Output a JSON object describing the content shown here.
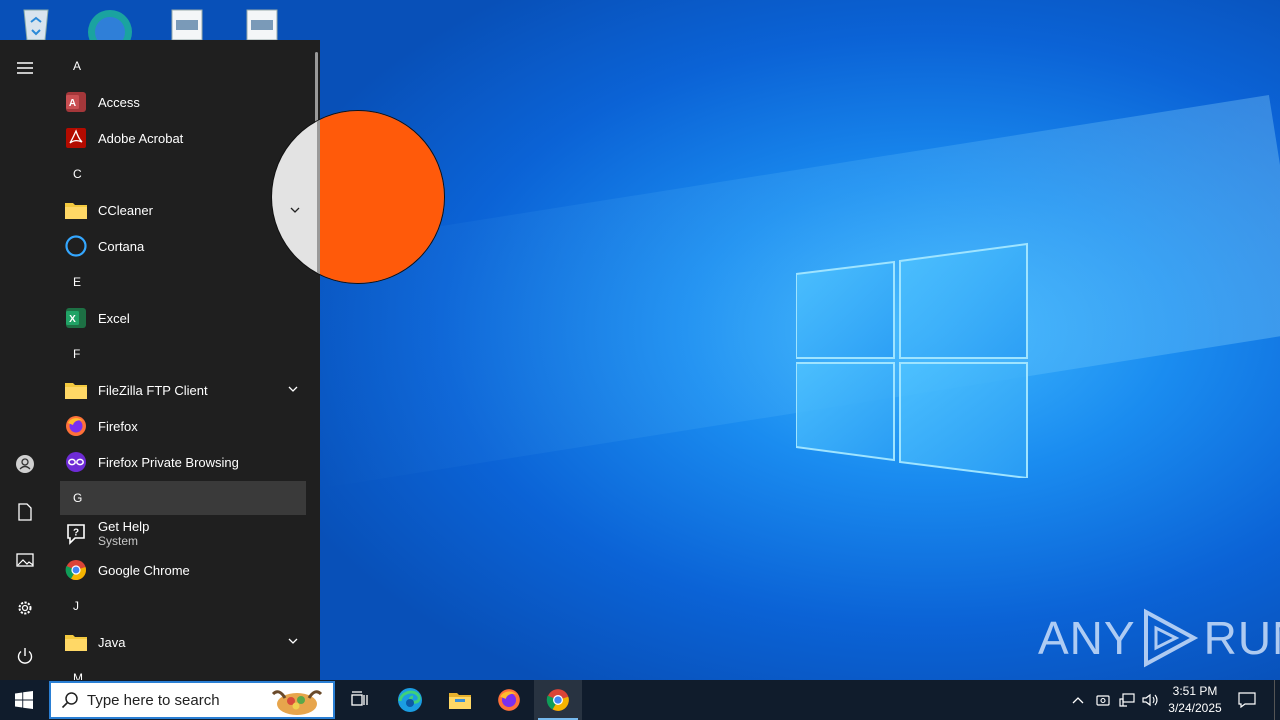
{
  "desktop": {
    "icons": [
      "recycle-bin",
      "edge",
      "document",
      "document"
    ],
    "watermark": {
      "left": "ANY",
      "right": "RUN"
    }
  },
  "start_menu": {
    "apps": [
      {
        "kind": "header",
        "label": "A"
      },
      {
        "kind": "app",
        "label": "Access",
        "icon": "access-icon"
      },
      {
        "kind": "app",
        "label": "Adobe Acrobat",
        "icon": "acrobat-icon"
      },
      {
        "kind": "header",
        "label": "C"
      },
      {
        "kind": "folder",
        "label": "CCleaner",
        "icon": "folder-icon",
        "expandable": true
      },
      {
        "kind": "app",
        "label": "Cortana",
        "icon": "cortana-icon"
      },
      {
        "kind": "header",
        "label": "E"
      },
      {
        "kind": "app",
        "label": "Excel",
        "icon": "excel-icon"
      },
      {
        "kind": "header",
        "label": "F"
      },
      {
        "kind": "folder",
        "label": "FileZilla FTP Client",
        "icon": "folder-icon",
        "expandable": true
      },
      {
        "kind": "app",
        "label": "Firefox",
        "icon": "firefox-icon"
      },
      {
        "kind": "app",
        "label": "Firefox Private Browsing",
        "icon": "firefox-private-icon"
      },
      {
        "kind": "header",
        "label": "G",
        "highlighted": true
      },
      {
        "kind": "app",
        "label": "Get Help",
        "sublabel": "System",
        "icon": "get-help-icon"
      },
      {
        "kind": "app",
        "label": "Google Chrome",
        "icon": "chrome-icon"
      },
      {
        "kind": "header",
        "label": "J"
      },
      {
        "kind": "folder",
        "label": "Java",
        "icon": "folder-icon",
        "expandable": true
      },
      {
        "kind": "header",
        "label": "M"
      }
    ],
    "rail": [
      "hamburger-menu-icon",
      "user-icon",
      "documents-icon",
      "pictures-icon",
      "settings-icon",
      "power-icon"
    ]
  },
  "taskbar": {
    "search_placeholder": "Type here to search",
    "pinned": [
      "task-view-icon",
      "edge-icon",
      "file-explorer-icon",
      "firefox-icon",
      "chrome-icon"
    ],
    "active": "chrome-icon",
    "clock": {
      "time": "3:51 PM",
      "date": "3/24/2025"
    }
  },
  "colors": {
    "taskbar": "#101c2c",
    "start_bg": "#1f1f1f",
    "accent": "#76b9ed",
    "cursor_fill": "#ff5a0a"
  }
}
